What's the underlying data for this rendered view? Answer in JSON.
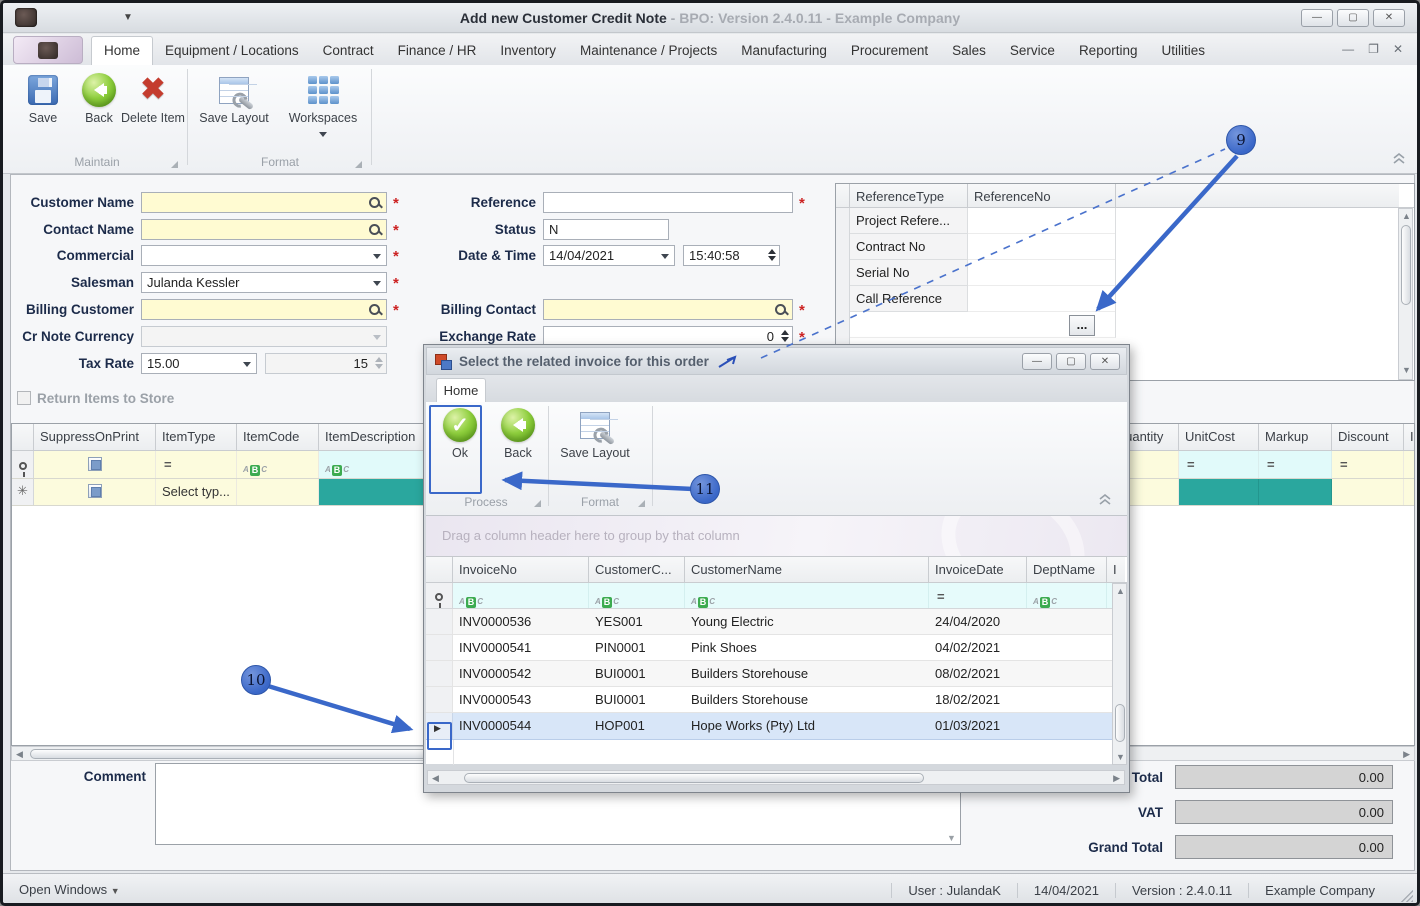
{
  "titlebar": {
    "title": "Add new Customer Credit Note",
    "subtitle": " - BPO: Version 2.4.0.11 - Example Company"
  },
  "menu": {
    "tabs": [
      "Home",
      "Equipment / Locations",
      "Contract",
      "Finance / HR",
      "Inventory",
      "Maintenance / Projects",
      "Manufacturing",
      "Procurement",
      "Sales",
      "Service",
      "Reporting",
      "Utilities"
    ]
  },
  "ribbon": {
    "save": "Save",
    "back": "Back",
    "delete_item": "Delete Item",
    "save_layout": "Save Layout",
    "workspaces": "Workspaces",
    "group_maintain": "Maintain",
    "group_format": "Format"
  },
  "form": {
    "customer_name_label": "Customer Name",
    "contact_name_label": "Contact Name",
    "commercial_label": "Commercial",
    "salesman_label": "Salesman",
    "salesman_value": "Julanda Kessler",
    "billing_customer_label": "Billing Customer",
    "cr_note_currency_label": "Cr Note Currency",
    "tax_rate_label": "Tax Rate",
    "tax_rate_value": "15.00",
    "tax_rate_amount": "15",
    "return_items_label": "Return Items to Store",
    "reference_label": "Reference",
    "status_label": "Status",
    "status_value": "N",
    "datetime_label": "Date & Time",
    "date_value": "14/04/2021",
    "time_value": "15:40:58",
    "billing_contact_label": "Billing Contact",
    "exchange_rate_label": "Exchange Rate",
    "exchange_rate_value": "0",
    "required_marker": "*"
  },
  "reference_grid": {
    "col_type": "ReferenceType",
    "col_no": "ReferenceNo",
    "rows": [
      "Project Refere...",
      "Contract No",
      "Serial No",
      "Call Reference"
    ],
    "ellipsis_button": "..."
  },
  "items_grid": {
    "columns": {
      "suppress": "SuppressOnPrint",
      "item_type": "ItemType",
      "item_code": "ItemCode",
      "item_desc": "ItemDescription",
      "quantity": "Quantity",
      "unit_cost": "UnitCost",
      "markup": "Markup",
      "discount": "Discount",
      "partial": "I"
    },
    "new_row_item_type": "Select typ...",
    "filter_equals": "="
  },
  "dialog": {
    "title": "Select the related invoice for this order",
    "tab_home": "Home",
    "ok": "Ok",
    "back": "Back",
    "save_layout": "Save Layout",
    "group_process": "Process",
    "group_format": "Format",
    "group_by_hint": "Drag a column header here to group by that column",
    "columns": {
      "invoice_no": "InvoiceNo",
      "customer_code": "CustomerC...",
      "customer_name": "CustomerName",
      "invoice_date": "InvoiceDate",
      "dept_name": "DeptName",
      "partial": "I"
    },
    "filter_equals": "=",
    "rows": [
      {
        "no": "INV0000536",
        "code": "YES001",
        "name": "Young Electric",
        "date": "24/04/2020"
      },
      {
        "no": "INV0000541",
        "code": "PIN0001",
        "name": "Pink Shoes",
        "date": "04/02/2021"
      },
      {
        "no": "INV0000542",
        "code": "BUI0001",
        "name": "Builders Storehouse",
        "date": "08/02/2021"
      },
      {
        "no": "INV0000543",
        "code": "BUI0001",
        "name": "Builders Storehouse",
        "date": "18/02/2021"
      },
      {
        "no": "INV0000544",
        "code": "HOP001",
        "name": "Hope Works (Pty) Ltd",
        "date": "01/03/2021"
      }
    ]
  },
  "bottom": {
    "comment_label": "Comment",
    "total_label": "Total",
    "vat_label": "VAT",
    "grand_total_label": "Grand Total",
    "total_value": "0.00",
    "vat_value": "0.00",
    "grand_total_value": "0.00"
  },
  "statusbar": {
    "open_windows": "Open Windows",
    "user": "User : JulandaK",
    "date": "14/04/2021",
    "version": "Version : 2.4.0.11",
    "company": "Example Company"
  },
  "callouts": {
    "nine": "9",
    "ten": "10",
    "eleven": "11"
  },
  "colors": {
    "accent_blue": "#3a68c9",
    "teal_cell": "#2aa79e",
    "field_yellow": "#fffbd2",
    "filter_cyan": "#e1fafa",
    "required_red": "#cc2222",
    "button_green": "#76b82a"
  }
}
